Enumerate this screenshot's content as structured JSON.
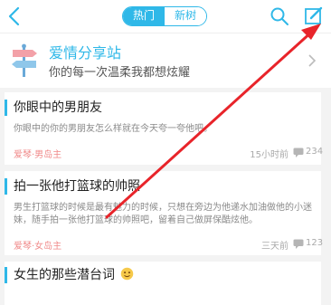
{
  "header": {
    "tabs": [
      {
        "label": "热门",
        "active": false
      },
      {
        "label": "新树",
        "active": true
      }
    ],
    "icons": [
      "back-icon",
      "search-icon",
      "compose-icon"
    ]
  },
  "banner": {
    "title": "爱情分享站",
    "subtitle": "你的每一次温柔我都想炫耀"
  },
  "posts": [
    {
      "title": "你眼中的男朋友",
      "body": "你眼中的你的男朋友怎么样就在今天夸一夸他吧。",
      "tag": "爱琴·男岛主",
      "time": "15小时前",
      "comments": "234"
    },
    {
      "title": "拍一张他打篮球的帅照",
      "body": "男生打篮球的时候是最有魅力的时候，只想在旁边为他递水加油做他的小迷妹，随手拍一张他打篮球的帅照吧，留着自己做屏保酷炫他。",
      "tag": "爱琴·女岛主",
      "time": "三天前",
      "comments": "123"
    },
    {
      "title": "女生的那些潜台词"
    }
  ],
  "colors": {
    "accent": "#2fb8e8",
    "arrow": "#e8242a",
    "tag": "#f08a8a"
  }
}
